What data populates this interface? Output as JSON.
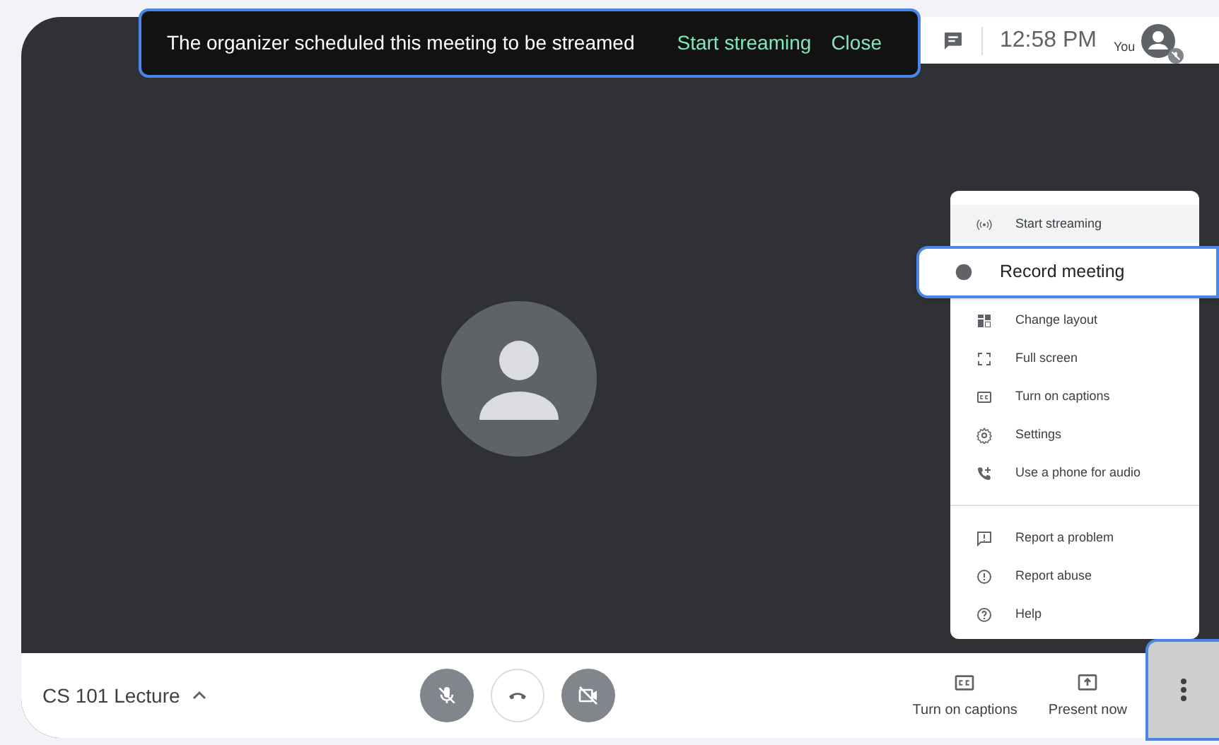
{
  "banner": {
    "message": "The organizer scheduled this meeting to be streamed",
    "actions": [
      "Start streaming",
      "Close"
    ]
  },
  "top_bar": {
    "time": "12:58 PM",
    "user_label": "You",
    "mic_muted": true
  },
  "menu": {
    "sections": [
      [
        {
          "label": "Start streaming",
          "highlighted": false,
          "hovered": true
        },
        {
          "label": "Record meeting",
          "highlighted": true,
          "hovered": false
        },
        {
          "label": "Change layout",
          "highlighted": false,
          "hovered": false
        },
        {
          "label": "Full screen",
          "highlighted": false,
          "hovered": false
        },
        {
          "label": "Turn on captions",
          "highlighted": false,
          "hovered": false
        },
        {
          "label": "Settings",
          "highlighted": false,
          "hovered": false
        },
        {
          "label": "Use a phone for audio",
          "highlighted": false,
          "hovered": false
        }
      ],
      [
        {
          "label": "Report a problem",
          "highlighted": false,
          "hovered": false
        },
        {
          "label": "Report abuse",
          "highlighted": false,
          "hovered": false
        },
        {
          "label": "Help",
          "highlighted": false,
          "hovered": false
        }
      ]
    ]
  },
  "bottom_bar": {
    "meeting_title": "CS 101 Lecture",
    "mic_off": true,
    "camera_off": true,
    "actions": [
      "Turn on captions",
      "Present now"
    ],
    "more_highlighted": true
  }
}
